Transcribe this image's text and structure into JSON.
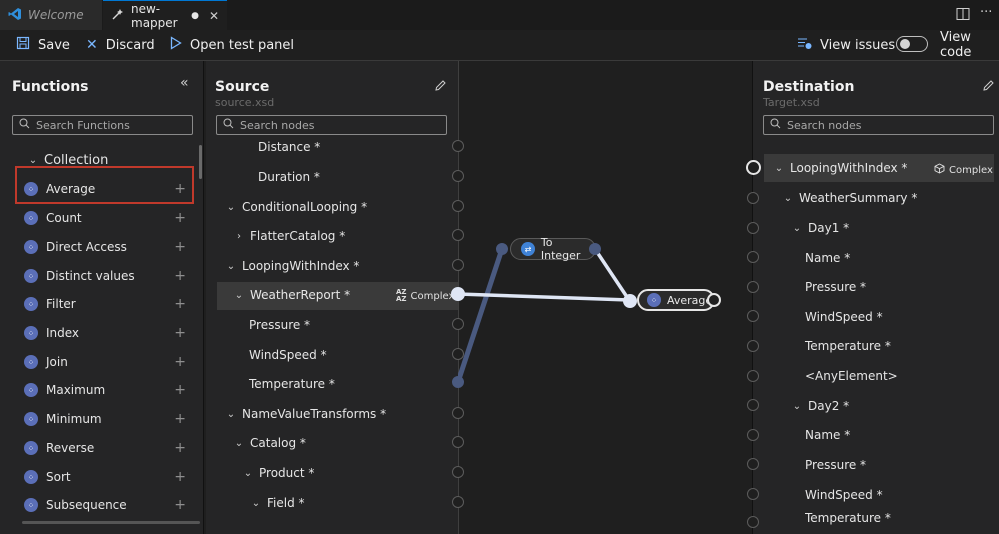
{
  "tabs": [
    {
      "label": "Welcome",
      "icon": "vscode-logo-icon",
      "active": false
    },
    {
      "label": "new-mapper",
      "icon": "mapper-file-icon",
      "modified_dot": "●",
      "active": true
    }
  ],
  "toolbar": {
    "save_label": "Save",
    "discard_label": "Discard",
    "open_test_panel_label": "Open test panel",
    "view_issues_label": "View issues",
    "view_code_label": "View code"
  },
  "functions": {
    "title": "Functions",
    "search_placeholder": "Search Functions",
    "collection_label": "Collection",
    "items": [
      {
        "label": "Average"
      },
      {
        "label": "Count"
      },
      {
        "label": "Direct Access"
      },
      {
        "label": "Distinct values"
      },
      {
        "label": "Filter"
      },
      {
        "label": "Index"
      },
      {
        "label": "Join"
      },
      {
        "label": "Maximum"
      },
      {
        "label": "Minimum"
      },
      {
        "label": "Reverse"
      },
      {
        "label": "Sort"
      },
      {
        "label": "Subsequence"
      }
    ]
  },
  "source": {
    "title": "Source",
    "file": "source.xsd",
    "search_placeholder": "Search nodes",
    "nodes": [
      {
        "label": "Distance *"
      },
      {
        "label": "Duration *"
      },
      {
        "label": "ConditionalLooping *"
      },
      {
        "label": "FlatterCatalog *"
      },
      {
        "label": "LoopingWithIndex *"
      },
      {
        "label": "WeatherReport *"
      },
      {
        "label": "Pressure *"
      },
      {
        "label": "WindSpeed *"
      },
      {
        "label": "Temperature *"
      },
      {
        "label": "NameValueTransforms *"
      },
      {
        "label": "Catalog *"
      },
      {
        "label": "Product *"
      },
      {
        "label": "Field *"
      }
    ],
    "complex_label": "Complex"
  },
  "canvas": {
    "to_integer_label": "To Integer",
    "average_label": "Average"
  },
  "destination": {
    "title": "Destination",
    "file": "Target.xsd",
    "search_placeholder": "Search nodes",
    "nodes": [
      {
        "label": "LoopingWithIndex *"
      },
      {
        "label": "WeatherSummary *"
      },
      {
        "label": "Day1 *"
      },
      {
        "label": "Name *"
      },
      {
        "label": "Pressure *"
      },
      {
        "label": "WindSpeed *"
      },
      {
        "label": "Temperature *"
      },
      {
        "label": "<AnyElement>"
      },
      {
        "label": "Day2 *"
      },
      {
        "label": "Name *"
      },
      {
        "label": "Pressure *"
      },
      {
        "label": "WindSpeed *"
      },
      {
        "label": "Temperature *"
      }
    ],
    "complex_label": "Complex"
  },
  "colors": {
    "accent": "#0078d4",
    "highlight_border": "#c0392b",
    "connection_line": "#dfe6f5",
    "function_icon": "#5b6fb8"
  }
}
